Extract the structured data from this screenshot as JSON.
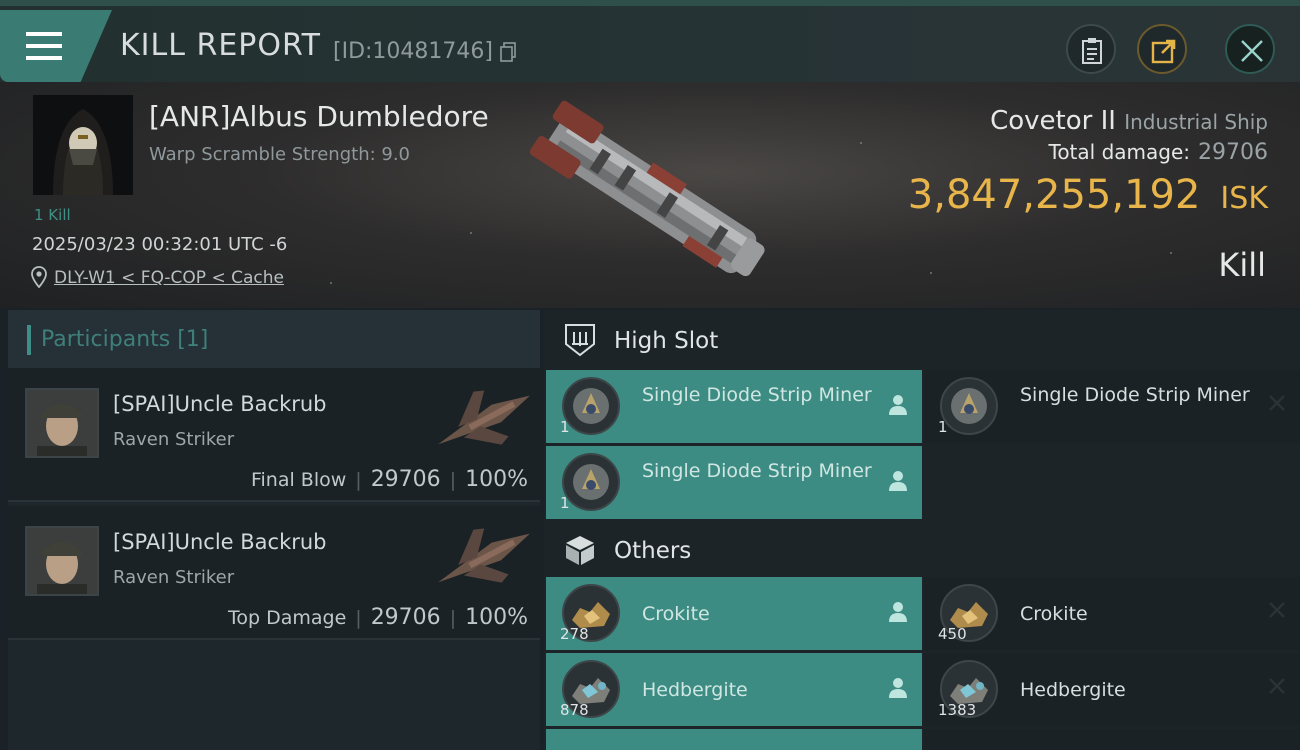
{
  "header": {
    "title": "KILL REPORT",
    "report_id": "[ID:10481746]"
  },
  "victim": {
    "name": "[ANR]Albus Dumbledore",
    "warp_scramble": "Warp Scramble Strength: 9.0",
    "kill_count": "1 Kill",
    "time": "2025/03/23 00:32:01 UTC -6",
    "location": "DLY-W1 < FQ-COP < Cache",
    "ship_name": "Covetor II",
    "ship_class": "Industrial Ship",
    "total_damage_label": "Total damage:",
    "total_damage": "29706",
    "isk_value": "3,847,255,192",
    "isk_unit": "ISK",
    "result": "Kill"
  },
  "participants": {
    "header": "Participants [1]",
    "rows": [
      {
        "name": "[SPAI]Uncle Backrub",
        "ship": "Raven Striker",
        "role": "Final Blow",
        "damage": "29706",
        "percent": "100%"
      },
      {
        "name": "[SPAI]Uncle Backrub",
        "ship": "Raven Striker",
        "role": "Top Damage",
        "damage": "29706",
        "percent": "100%"
      }
    ]
  },
  "fitting": {
    "high_slot_label": "High Slot",
    "others_label": "Others",
    "high_slot": [
      {
        "name": "Single Diode Strip Miner",
        "qty": "1",
        "state": "fitted"
      },
      {
        "name": "Single Diode Strip Miner",
        "qty": "1",
        "state": "dropped"
      },
      {
        "name": "Single Diode Strip Miner",
        "qty": "1",
        "state": "fitted"
      }
    ],
    "others": [
      {
        "name": "Crokite",
        "qty": "278",
        "state": "fitted"
      },
      {
        "name": "Crokite",
        "qty": "450",
        "state": "dropped"
      },
      {
        "name": "Hedbergite",
        "qty": "878",
        "state": "fitted"
      },
      {
        "name": "Hedbergite",
        "qty": "1383",
        "state": "dropped"
      }
    ]
  },
  "icons": {
    "menu": "hamburger-icon",
    "copy": "copy-icon",
    "clipboard": "clipboard-icon",
    "share": "share-icon",
    "close": "close-icon",
    "location": "location-pin-icon",
    "high_slot": "high-slot-icon",
    "others": "cargo-box-icon",
    "pilot": "pilot-icon",
    "destroyed": "x-mark-icon"
  },
  "colors": {
    "accent": "#3d8c83",
    "isk": "#e8b54a",
    "background": "#1b2227"
  }
}
